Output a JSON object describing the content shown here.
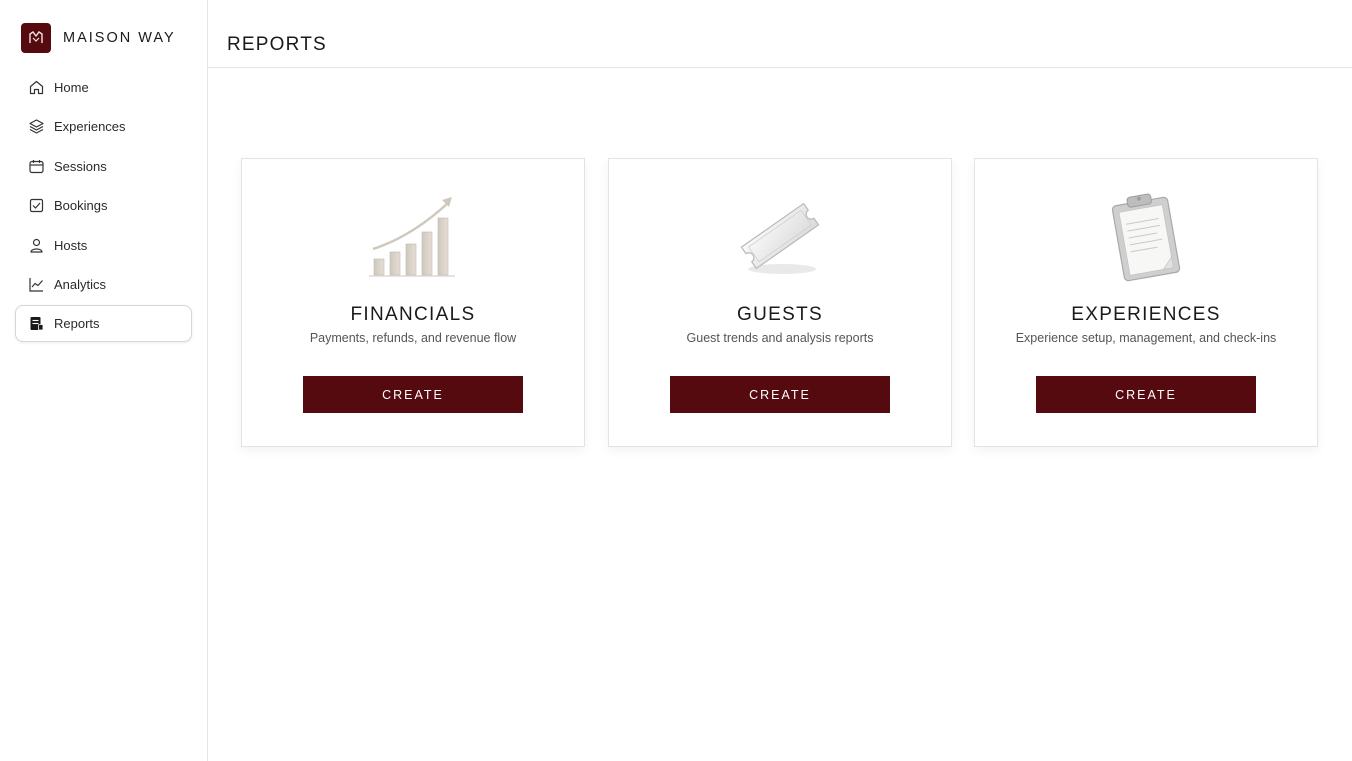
{
  "brand": {
    "name": "MAISON WAY"
  },
  "sidebar": {
    "items": [
      {
        "label": "Home",
        "icon": "home-icon"
      },
      {
        "label": "Experiences",
        "icon": "layers-icon"
      },
      {
        "label": "Sessions",
        "icon": "calendar-icon"
      },
      {
        "label": "Bookings",
        "icon": "booking-icon"
      },
      {
        "label": "Hosts",
        "icon": "user-icon"
      },
      {
        "label": "Analytics",
        "icon": "chart-line-icon"
      },
      {
        "label": "Reports",
        "icon": "report-icon",
        "active": true
      }
    ]
  },
  "header": {
    "title": "REPORTS"
  },
  "cards": [
    {
      "title": "FINANCIALS",
      "description": "Payments, refunds, and revenue flow",
      "button": "CREATE",
      "illustration": "growth-chart-illustration"
    },
    {
      "title": "GUESTS",
      "description": "Guest trends and analysis reports",
      "button": "CREATE",
      "illustration": "ticket-illustration"
    },
    {
      "title": "EXPERIENCES",
      "description": "Experience setup, management, and check-ins",
      "button": "CREATE",
      "illustration": "clipboard-illustration"
    }
  ],
  "colors": {
    "accent": "#550a10",
    "border": "#e6e6e6"
  }
}
